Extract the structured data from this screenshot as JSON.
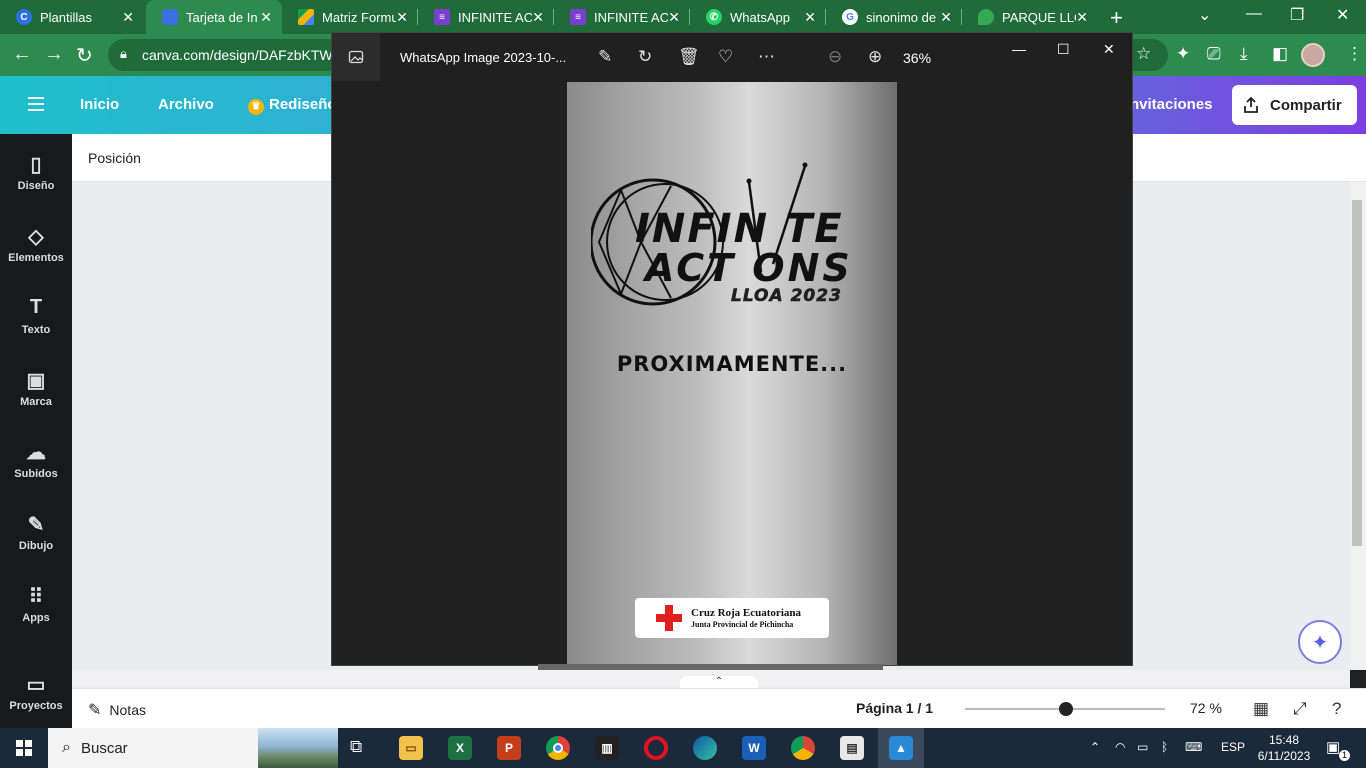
{
  "browser": {
    "tabs": [
      {
        "label": "Plantillas",
        "color": "#2f6fe6",
        "glyph": "C"
      },
      {
        "label": "Tarjeta de In",
        "color": "#3b6fe0",
        "glyph": ""
      },
      {
        "label": "Matriz Formu",
        "color": "#f5b400",
        "glyph": ""
      },
      {
        "label": "INFINITE AC",
        "color": "#7b3fd0",
        "glyph": ""
      },
      {
        "label": "INFINITE AC",
        "color": "#7b3fd0",
        "glyph": ""
      },
      {
        "label": "WhatsApp",
        "color": "#25d366",
        "glyph": ""
      },
      {
        "label": "sinonimo de",
        "color": "#ffffff",
        "glyph": "G"
      },
      {
        "label": "PARQUE LLO",
        "color": "#34a853",
        "glyph": ""
      }
    ],
    "url": "canva.com/design/DAFzbKTW-"
  },
  "canva": {
    "menu": {
      "home": "Inicio",
      "file": "Archivo",
      "resize": "Rediseño",
      "invitations": "nvitaciones",
      "share": "Compartir"
    },
    "sidebar": [
      {
        "label": "Diseño",
        "icon": "layout-icon",
        "glyph": "▯"
      },
      {
        "label": "Elementos",
        "icon": "shapes-icon",
        "glyph": "◇"
      },
      {
        "label": "Texto",
        "icon": "text-icon",
        "glyph": "T"
      },
      {
        "label": "Marca",
        "icon": "brand-icon",
        "glyph": "▣"
      },
      {
        "label": "Subidos",
        "icon": "upload-cloud-icon",
        "glyph": "☁"
      },
      {
        "label": "Dibujo",
        "icon": "draw-icon",
        "glyph": "✎"
      },
      {
        "label": "Apps",
        "icon": "apps-grid-icon",
        "glyph": "⠿"
      },
      {
        "label": "Proyectos",
        "icon": "folder-icon",
        "glyph": "▭"
      }
    ],
    "position_label": "Posición",
    "footer": {
      "notes": "Notas",
      "page_indicator": "Página 1 / 1",
      "zoom": "72 %"
    }
  },
  "viewer": {
    "title": "WhatsApp Image 2023-10-...",
    "zoom": "36%",
    "poster": {
      "logo_line1": "INFIN TE",
      "logo_line2": "ACT ONS",
      "logo_line3": "LLOA 2023",
      "headline": "PROXIMAMENTE...",
      "org_name": "Cruz Roja Ecuatoriana",
      "org_sub": "Junta Provincial de Pichincha"
    }
  },
  "taskbar": {
    "search": "Buscar",
    "lang": "ESP",
    "time": "15:48",
    "date": "6/11/2023",
    "notif_count": "1"
  }
}
